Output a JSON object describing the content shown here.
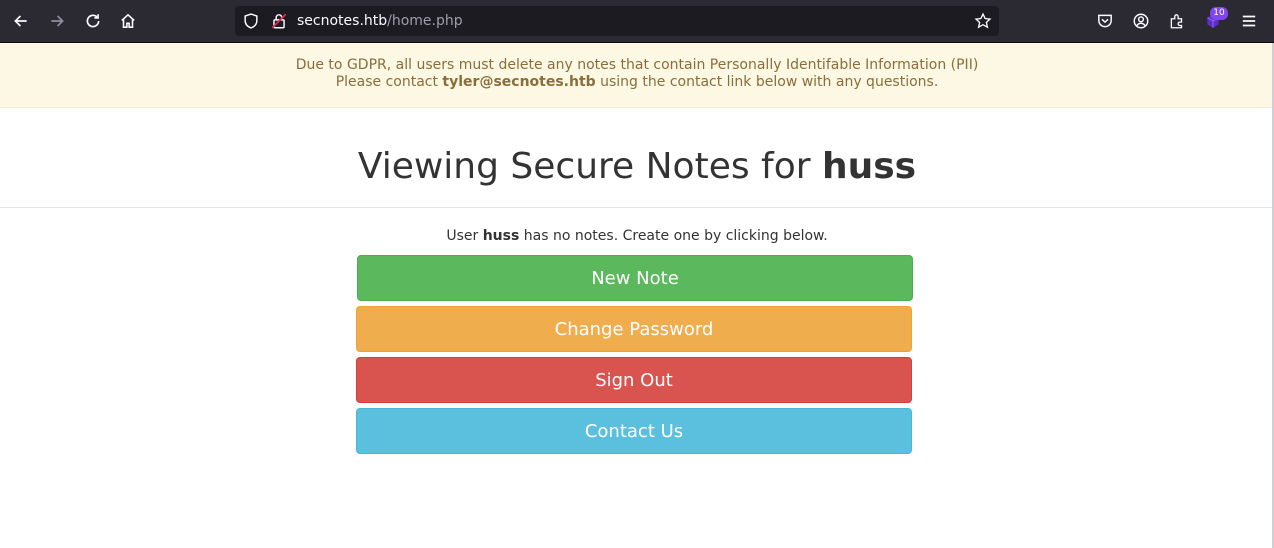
{
  "browser": {
    "url_host": "secnotes.htb",
    "url_path": "/home.php",
    "extension_badge": "10"
  },
  "banner": {
    "line1": "Due to GDPR, all users must delete any notes that contain Personally Identifable Information (PII)",
    "line2_prefix": "Please contact ",
    "line2_email": "tyler@secnotes.htb",
    "line2_suffix": " using the contact link below with any questions."
  },
  "heading": {
    "prefix": "Viewing Secure Notes for ",
    "username": "huss"
  },
  "notice": {
    "prefix": "User ",
    "username": "huss",
    "suffix": " has no notes. Create one by clicking below."
  },
  "buttons": {
    "new_note": "New Note",
    "change_password": "Change Password",
    "sign_out": "Sign Out",
    "contact_us": "Contact Us"
  },
  "colors": {
    "success": "#5cb85c",
    "warning": "#f0ad4e",
    "danger": "#d9534f",
    "info": "#5bc0de",
    "banner_bg": "#fcf8e3",
    "banner_text": "#8a6d3b"
  }
}
